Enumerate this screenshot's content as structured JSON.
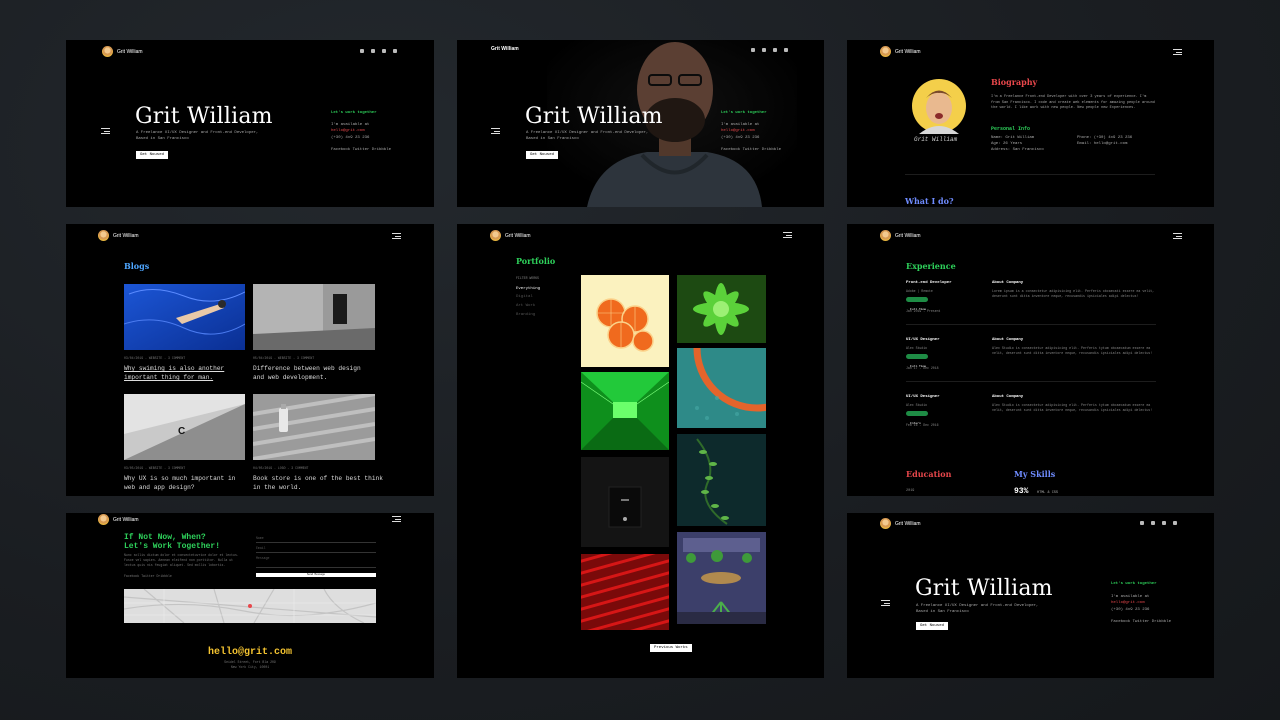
{
  "brand": {
    "name": "Grit William",
    "name_short": "Grit William"
  },
  "hero": {
    "name": "Grit William",
    "tagline_1": "A Freelance UI/UX Designer and Front-end Developer,",
    "tagline_2": "Based in San Francisco",
    "button": "Get Noused",
    "work_title": "Let's work together",
    "available": "I'm available at",
    "email": "hello@grit.com",
    "phone": "(+30) 4x9 23 236",
    "social_links": "Facebook  Twitter  Dribbble"
  },
  "hero2": {
    "available": "I'm available at",
    "email": "hello@grit.com",
    "phone": "(+30) 4x9 23 236"
  },
  "bio": {
    "title": "Biography",
    "text": "I'm a Freelance Front-end Developer with over 3 years of experience. I'm from San Francisco. I code and create web elements for amazing people around the world. I like work with new people. New people new Experiences.",
    "personal_title": "Personal Info",
    "name_label": "Name: Grit William",
    "age_label": "Age: 26 Years",
    "address_label": "Address: San Francisco",
    "phone_label": "Phone: (+30) 4x9 23 236",
    "email_label": "Email: hello@grit.com",
    "signature": "Grit William",
    "what_i_do": "What I do?"
  },
  "blogs": {
    "title": "Blogs",
    "posts": [
      {
        "meta": "03/04/2019 - WEBSITE - 3 COMMENT",
        "title_1": "Why swiming is also another",
        "title_2": "important thing for man."
      },
      {
        "meta": "05/04/2019 - WEBSITE - 3 COMMENT",
        "title_1": "Difference between web design",
        "title_2": "and web development."
      },
      {
        "meta": "03/05/2019 - WEBSITE - 3 COMMENT",
        "title_1": "Why UX is so much important in",
        "title_2": "web and app design?"
      },
      {
        "meta": "04/05/2019 - LOGO - 3 COMMENT",
        "title_1": "Book store is one of the best think",
        "title_2": "in the world."
      }
    ]
  },
  "portfolio": {
    "title": "Portfolio",
    "filter_label": "FILTER WORKS",
    "filters": [
      "Everything",
      "Digital",
      "Art Work",
      "Branding"
    ],
    "button": "Previous Works"
  },
  "experience": {
    "title": "Experience",
    "items": [
      {
        "role": "Front-end Developer",
        "company_sub": "Adobe | Remote",
        "tag": "Full Time",
        "date": "Jan 2019 - Present",
        "about": "About Company",
        "desc": "Lorem ipsum is a consectetur adipisicing elit. Perferis obcaecati essere ea velit, deserunt sunt ditta inventore neque, recusandis ipsiciales adipi delectus!"
      },
      {
        "role": "UI/UX Designer",
        "company_sub": "Alex Studio",
        "tag": "Full Time",
        "date": "Jan 17 - Dec 2018",
        "about": "About Company",
        "desc": "Alex Studio is consectetur adipisicing elit. Perferis tytum obcaecatum essere ea velit, deserunt sunt ditta inventore neque, recusandis ipsiciales adipi delectus!"
      },
      {
        "role": "UI/UX Designer",
        "company_sub": "Alex Studio",
        "tag": "Intern",
        "date": "Feb 16 - Dec 2016",
        "about": "About Company",
        "desc": "Alex Studio is consectetur adipisicing elit. Perferis tytum obcaecatum essere ea velit, deserunt sunt ditta inventore neque, recusandis ipsiciales adipi delectus!"
      }
    ],
    "education": "Education",
    "skills": "My Skills",
    "year": "2019",
    "skill_pct": "93%",
    "skill_name": "HTML & CSS"
  },
  "contact": {
    "title_1": "If Not Now, When?",
    "title_2": "Let's Work Together!",
    "body": "Nunc sollis dictum dolor et consectetuvrice dolor et lectus. Fusce vel sapien. Aenean eleifend non porttitor. Nulla ut lectus quis nis feugiat aliquet. Sed mollis lobortis.",
    "social": "Facebook  Twitter  Dribbble",
    "name_ph": "Name",
    "email_ph": "Email",
    "msg_ph": "Message",
    "send": "Send Message",
    "big_email": "hello@grit.com",
    "address_1": "Seidel Street, Fort Bla 209",
    "address_2": "New York City, 10001"
  },
  "colors": {
    "accent_green": "#2ed15b",
    "accent_red": "#e8474b",
    "accent_blue": "#6f8cff",
    "accent_yellow": "#f5c430"
  }
}
